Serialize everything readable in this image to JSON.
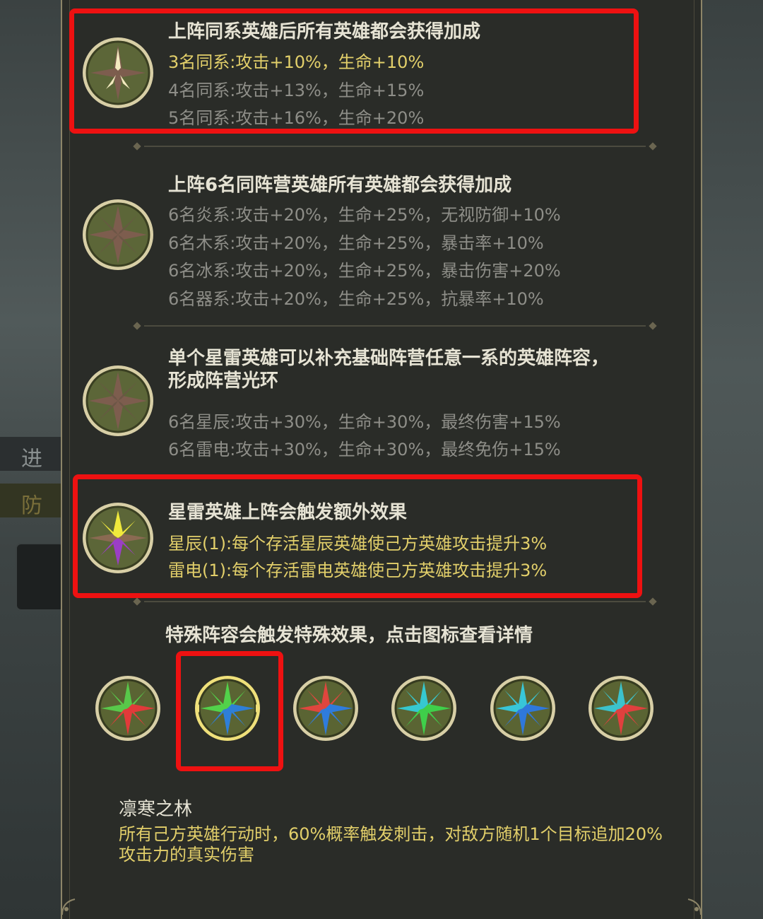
{
  "background": {
    "side_label_1": "进",
    "side_label_2": "防"
  },
  "bonus_sections": [
    {
      "title": "上阵同系英雄后所有英雄都会获得加成",
      "highlighted": true,
      "lines": [
        {
          "text": "3名同系:攻击+10%，生命+10%",
          "active": true
        },
        {
          "text": "4名同系:攻击+13%，生命+15%",
          "active": false
        },
        {
          "text": "5名同系:攻击+16%，生命+20%",
          "active": false
        }
      ]
    },
    {
      "title": "上阵6名同阵营英雄所有英雄都会获得加成",
      "highlighted": false,
      "lines": [
        {
          "text": "6名炎系:攻击+20%，生命+25%，无视防御+10%",
          "active": false
        },
        {
          "text": "6名木系:攻击+20%，生命+25%，暴击率+10%",
          "active": false
        },
        {
          "text": "6名冰系:攻击+20%，生命+25%，暴击伤害+20%",
          "active": false
        },
        {
          "text": "6名器系:攻击+20%，生命+25%，抗暴率+10%",
          "active": false
        }
      ]
    },
    {
      "title_line_1": "单个星雷英雄可以补充基础阵营任意一系的英雄阵容，",
      "title_line_2": "形成阵营光环",
      "highlighted": false,
      "lines": [
        {
          "text": "6名星辰:攻击+30%，生命+30%，最终伤害+15%",
          "active": false
        },
        {
          "text": "6名雷电:攻击+30%，生命+30%，最终免伤+15%",
          "active": false
        }
      ]
    },
    {
      "title": "星雷英雄上阵会触发额外效果",
      "highlighted": true,
      "lines": [
        {
          "text": "星辰(1):每个存活星辰英雄使己方英雄攻击提升3%",
          "active": true
        },
        {
          "text": "雷电(1):每个存活雷电英雄使己方英雄攻击提升3%",
          "active": true
        }
      ]
    }
  ],
  "special_lineups": {
    "title": "特殊阵容会触发特殊效果，点击图标查看详情",
    "selected_index": 1,
    "icons": [
      {
        "icon": "green-red-compass-icon",
        "colors": [
          "#58c84a",
          "#e23a3a"
        ]
      },
      {
        "icon": "green-blue-compass-icon",
        "colors": [
          "#52d24a",
          "#2e7fd8"
        ]
      },
      {
        "icon": "red-blue-compass-icon",
        "colors": [
          "#e0463e",
          "#2f7cdd"
        ]
      },
      {
        "icon": "cyan-green-compass-icon",
        "colors": [
          "#36c8d0",
          "#3fcf4a"
        ]
      },
      {
        "icon": "cyan-blue-compass-icon",
        "colors": [
          "#38c6d8",
          "#2f78dc"
        ]
      },
      {
        "icon": "cyan-red-compass-icon",
        "colors": [
          "#3cc2cc",
          "#e0403e"
        ]
      }
    ],
    "detail_name": "凛寒之林",
    "detail_text": "所有己方英雄行动时，60%概率触发刺击，对敌方随机1个目标追加20%攻击力的真实伤害"
  },
  "colors": {
    "highlight_border": "#ee1111",
    "active_text": "#e2cf6a",
    "inactive_text": "#8e8e88",
    "title_text": "#e6e3d4",
    "panel_bg": "#2a2c28"
  }
}
